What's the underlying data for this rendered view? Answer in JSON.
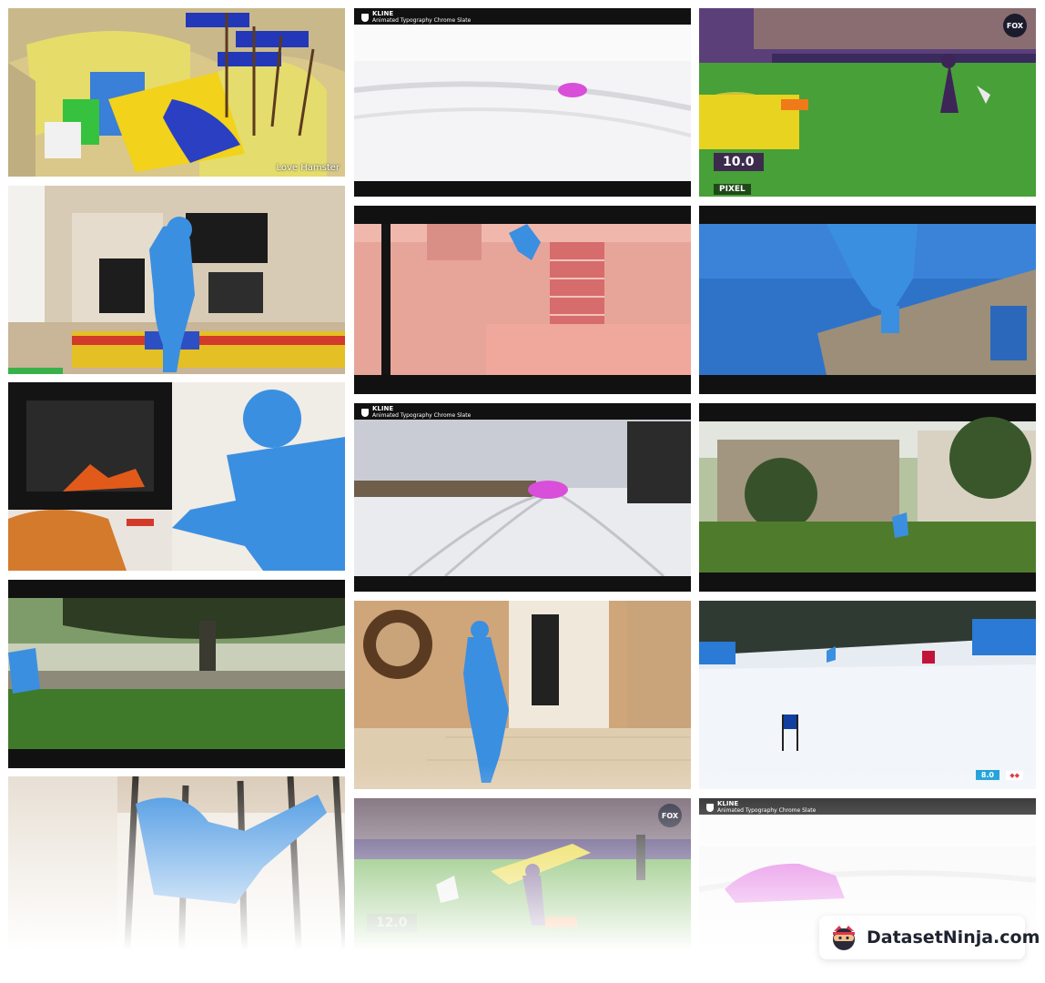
{
  "tiles": [
    {
      "id": "hamster",
      "caption": "Love Hamster"
    },
    {
      "id": "snow-car-1",
      "kline": {
        "brand": "KLINE",
        "sub": "Animated Typography Chrome Slate"
      }
    },
    {
      "id": "dog-agility-1",
      "score": "10.0",
      "score_label": "PIXEL",
      "fox": "FOX"
    },
    {
      "id": "living-room"
    },
    {
      "id": "pink-building"
    },
    {
      "id": "parkour-wall"
    },
    {
      "id": "fireplace-cat"
    },
    {
      "id": "snow-car-2",
      "kline": {
        "brand": "KLINE",
        "sub": "Animated Typography Chrome Slate"
      }
    },
    {
      "id": "garden-runner"
    },
    {
      "id": "garden-pavilion"
    },
    {
      "id": "hallway"
    },
    {
      "id": "ski-slope",
      "timer": "8.0",
      "timer_flag": "◆◆"
    },
    {
      "id": "stair-railing"
    },
    {
      "id": "dog-agility-2",
      "score": "12.0",
      "fox": "FOX"
    },
    {
      "id": "snow-car-3",
      "kline": {
        "brand": "KLINE",
        "sub": "Animated Typography Chrome Slate"
      }
    }
  ],
  "watermark": {
    "text": "DatasetNinja.com"
  }
}
